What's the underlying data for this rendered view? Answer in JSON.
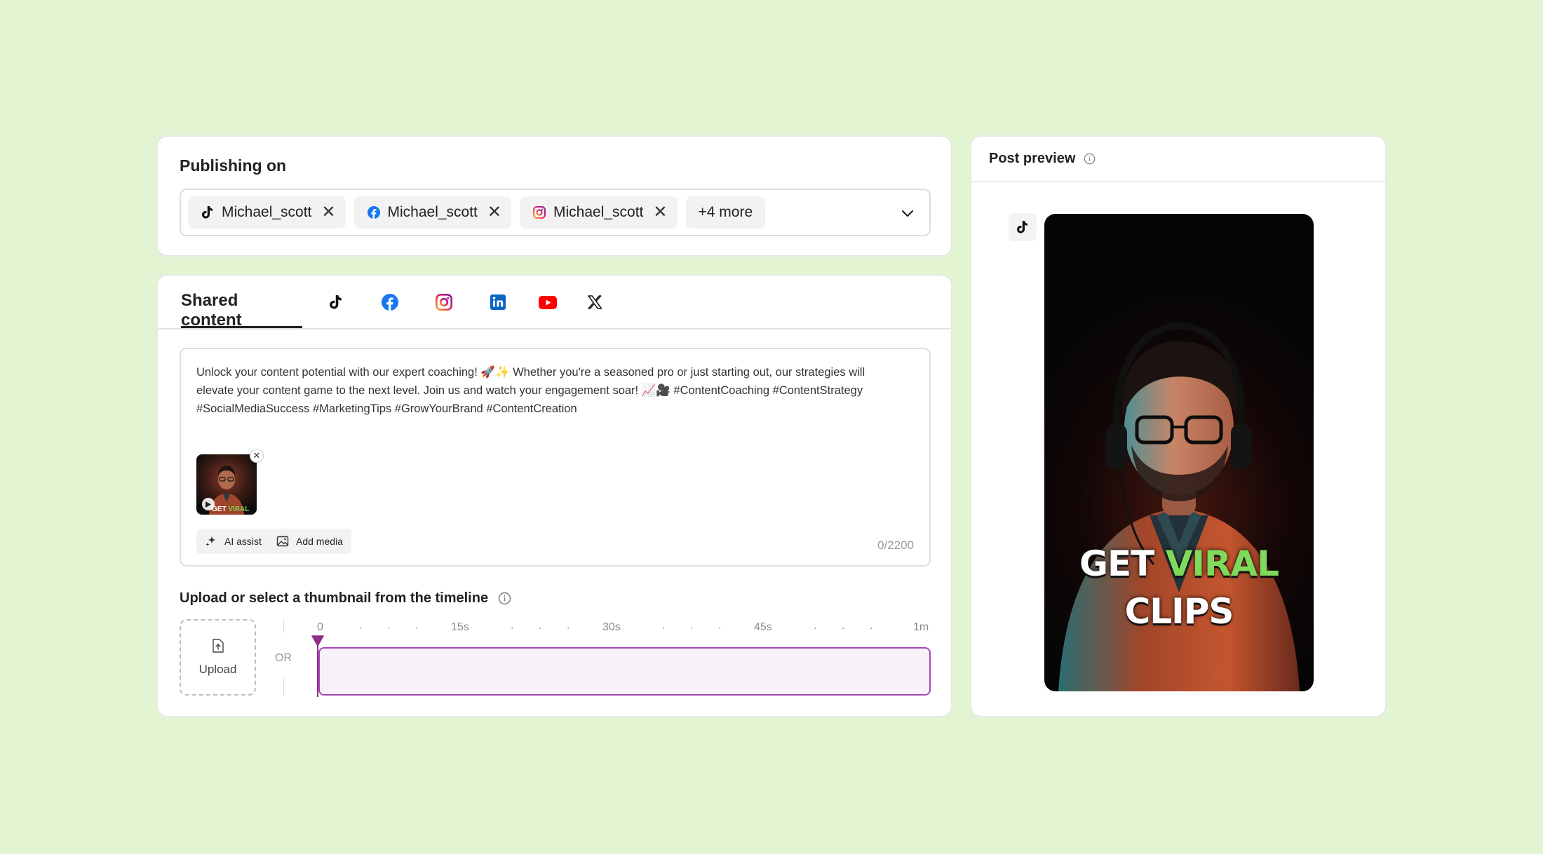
{
  "publishing": {
    "title": "Publishing on",
    "accounts": [
      {
        "platform": "tiktok",
        "name": "Michael_scott"
      },
      {
        "platform": "facebook",
        "name": "Michael_scott"
      },
      {
        "platform": "instagram",
        "name": "Michael_scott"
      }
    ],
    "more_label": "+4 more"
  },
  "editor": {
    "tabs": {
      "shared": "Shared content",
      "icons": [
        "tiktok-icon",
        "facebook-icon",
        "instagram-icon",
        "linkedin-icon",
        "youtube-icon",
        "x-icon"
      ]
    },
    "post_text": "Unlock your content potential with our expert coaching! 🚀✨ Whether you're a seasoned pro or just starting out, our strategies will elevate your content game to the next level. Join us and watch your engagement soar! 📈🎥 #ContentCoaching #ContentStrategy #SocialMediaSuccess #MarketingTips #GrowYourBrand #ContentCreation",
    "thumb_caption_a": "GET",
    "thumb_caption_b": "VIRAL",
    "ai_assist_label": "AI assist",
    "add_media_label": "Add media",
    "char_counter": "0/2200"
  },
  "thumbnail": {
    "title": "Upload or select a thumbnail from the timeline",
    "upload_label": "Upload",
    "or_label": "OR",
    "ticks": [
      "0",
      "15s",
      "30s",
      "45s",
      "1m"
    ],
    "playhead_position": 0
  },
  "preview": {
    "title": "Post preview",
    "caption_line1_a": "GET",
    "caption_line1_b": "VIRAL",
    "caption_line2": "CLIPS"
  },
  "colors": {
    "page_bg": "#e3f4d3",
    "timeline_accent": "#a548b4",
    "caption_green": "#7fd95a"
  }
}
